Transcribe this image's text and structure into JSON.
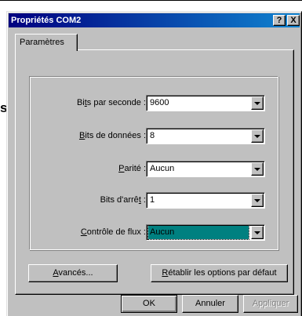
{
  "window": {
    "title": "Propriétés COM2",
    "help_label": "?",
    "close_label": "X"
  },
  "background": {
    "text": "s"
  },
  "tabs": [
    {
      "label": "Paramètres",
      "active": true
    }
  ],
  "fields": [
    {
      "label_pre": "Bi",
      "label_u": "t",
      "label_post": "s par seconde :",
      "value": "9600"
    },
    {
      "label_pre": "",
      "label_u": "B",
      "label_post": "its de données :",
      "value": "8"
    },
    {
      "label_pre": "",
      "label_u": "P",
      "label_post": "arité :",
      "value": "Aucun"
    },
    {
      "label_pre": "Bits d'arrê",
      "label_u": "t",
      "label_post": " :",
      "value": "1"
    },
    {
      "label_pre": "",
      "label_u": "C",
      "label_post": "ontrôle de flux :",
      "value": "Aucun",
      "selected": true
    }
  ],
  "buttons": {
    "advanced": {
      "u": "A",
      "rest": "vancés..."
    },
    "restore": {
      "u": "R",
      "rest": "établir les options par défaut"
    },
    "ok": "OK",
    "cancel": "Annuler",
    "apply": "Appliquer"
  },
  "colors": {
    "titlebar_start": "#000080",
    "titlebar_end": "#1084d0",
    "selection": "#008080",
    "face": "#c0c0c0"
  }
}
